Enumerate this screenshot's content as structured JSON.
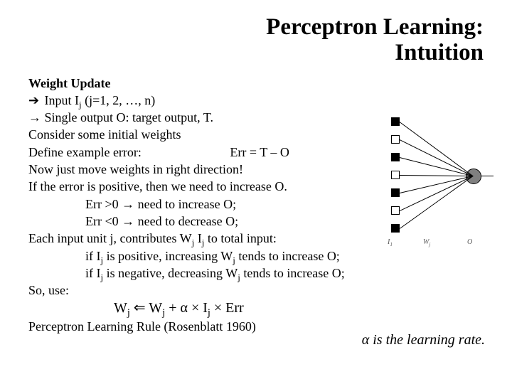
{
  "title_line1": "Perceptron Learning:",
  "title_line2": "Intuition",
  "heading": "Weight Update",
  "lines": {
    "l1_pre": "Input I",
    "l1_sub": "j",
    "l1_post": " (j=1, 2, …, n)",
    "l2": "Single output O: target output, T.",
    "l3": "Consider some initial weights",
    "l4_label": "Define example error:",
    "l4_formula": "Err = T – O",
    "l5": "Now just move weights in right direction!",
    "l6": "If the error is positive, then we need to increase O.",
    "l7_a": "Err >0 ",
    "l7_b": " need to increase O;",
    "l8_a": "Err <0 ",
    "l8_b": " need to decrease O;",
    "l9_a": "Each input unit j, contributes W",
    "l9_sub1": "j",
    "l9_b": " I",
    "l9_sub2": "j",
    "l9_c": " to total input:",
    "l10_a": "if I",
    "l10_sub": "j",
    "l10_b": " is positive, increasing W",
    "l10_sub2": "j",
    "l10_c": " tends to increase O;",
    "l11_a": "if I",
    "l11_sub": "j",
    "l11_b": " is negative, decreasing W",
    "l11_sub2": "j",
    "l11_c": " tends to increase O;",
    "l12": "So, use:",
    "formula_a": "W",
    "formula_sub1": "j",
    "formula_arrow": " ⇐ ",
    "formula_b": "W",
    "formula_sub2": "j",
    "formula_c": " + α × I",
    "formula_sub3": "j",
    "formula_d": " × Err",
    "footer": "Perceptron Learning Rule (Rosenblatt 1960)"
  },
  "rate_note_a": "α",
  "rate_note_b": " is the learning rate.",
  "arrows": {
    "right_filled": "➔",
    "right_hollow": "→"
  },
  "diagram": {
    "labels": {
      "I": "I",
      "W": "W",
      "O": "O"
    },
    "sub1": "1",
    "sub2": "j"
  }
}
